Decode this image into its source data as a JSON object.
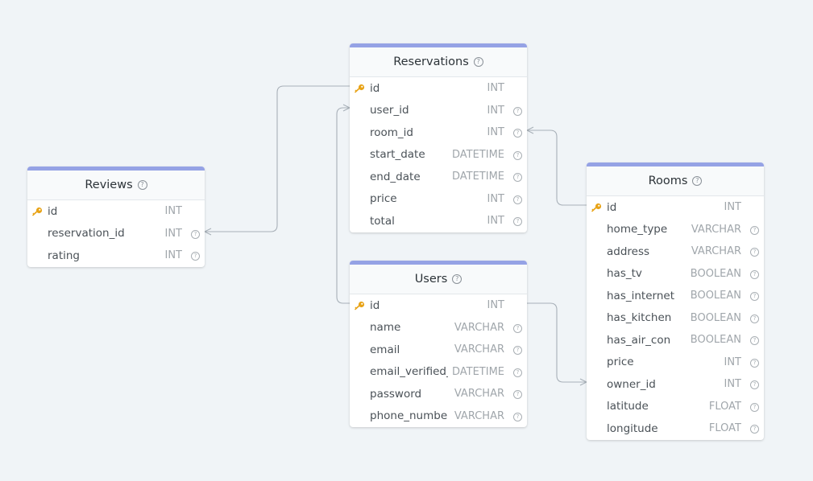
{
  "colors": {
    "background": "#f0f4f7",
    "header_bar": "#95a2e5",
    "primary_key": "#e8a317",
    "connector": "#a8b0b8"
  },
  "tables": {
    "reviews": {
      "title": "Reviews",
      "fields": [
        {
          "name": "id",
          "type": "INT",
          "pk": true
        },
        {
          "name": "reservation_id",
          "type": "INT",
          "pk": false
        },
        {
          "name": "rating",
          "type": "INT",
          "pk": false
        }
      ]
    },
    "reservations": {
      "title": "Reservations",
      "fields": [
        {
          "name": "id",
          "type": "INT",
          "pk": true
        },
        {
          "name": "user_id",
          "type": "INT",
          "pk": false
        },
        {
          "name": "room_id",
          "type": "INT",
          "pk": false
        },
        {
          "name": "start_date",
          "type": "DATETIME",
          "pk": false
        },
        {
          "name": "end_date",
          "type": "DATETIME",
          "pk": false
        },
        {
          "name": "price",
          "type": "INT",
          "pk": false
        },
        {
          "name": "total",
          "type": "INT",
          "pk": false
        }
      ]
    },
    "users": {
      "title": "Users",
      "fields": [
        {
          "name": "id",
          "type": "INT",
          "pk": true
        },
        {
          "name": "name",
          "type": "VARCHAR",
          "pk": false
        },
        {
          "name": "email",
          "type": "VARCHAR",
          "pk": false
        },
        {
          "name": "email_verified_at",
          "type": "DATETIME",
          "pk": false
        },
        {
          "name": "password",
          "type": "VARCHAR",
          "pk": false
        },
        {
          "name": "phone_number",
          "type": "VARCHAR",
          "pk": false
        }
      ]
    },
    "rooms": {
      "title": "Rooms",
      "fields": [
        {
          "name": "id",
          "type": "INT",
          "pk": true
        },
        {
          "name": "home_type",
          "type": "VARCHAR",
          "pk": false
        },
        {
          "name": "address",
          "type": "VARCHAR",
          "pk": false
        },
        {
          "name": "has_tv",
          "type": "BOOLEAN",
          "pk": false
        },
        {
          "name": "has_internet",
          "type": "BOOLEAN",
          "pk": false
        },
        {
          "name": "has_kitchen",
          "type": "BOOLEAN",
          "pk": false
        },
        {
          "name": "has_air_con",
          "type": "BOOLEAN",
          "pk": false
        },
        {
          "name": "price",
          "type": "INT",
          "pk": false
        },
        {
          "name": "owner_id",
          "type": "INT",
          "pk": false
        },
        {
          "name": "latitude",
          "type": "FLOAT",
          "pk": false
        },
        {
          "name": "longitude",
          "type": "FLOAT",
          "pk": false
        }
      ]
    }
  },
  "help_icon": "?",
  "key_icon": "key-icon",
  "relations": [
    {
      "from": "reviews.reservation_id",
      "to": "reservations.id"
    },
    {
      "from": "reservations.user_id",
      "to": "users.id"
    },
    {
      "from": "reservations.room_id",
      "to": "rooms.id"
    },
    {
      "from": "rooms.owner_id",
      "to": "users.id"
    }
  ]
}
